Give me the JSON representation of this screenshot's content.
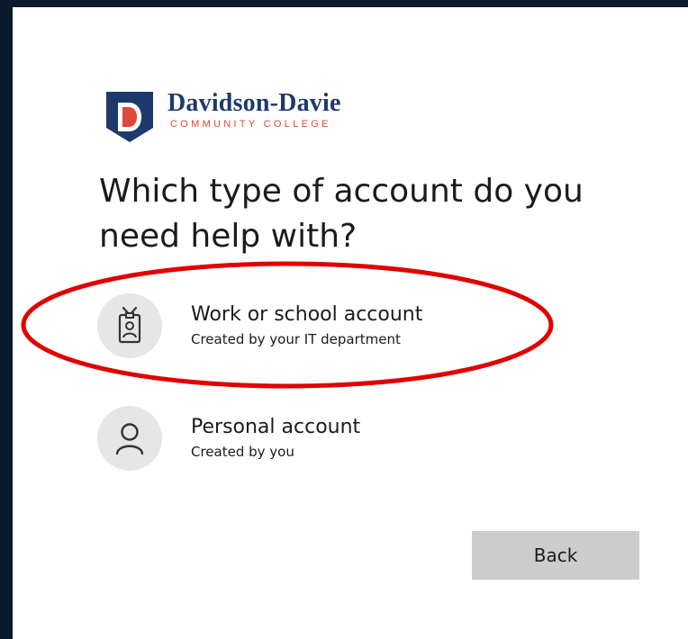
{
  "brand": {
    "name": "Davidson-Davie",
    "subtitle": "COMMUNITY COLLEGE",
    "logo_icon": "shield-d-logo",
    "colors": {
      "navy": "#1d3a6b",
      "red": "#e0463a"
    }
  },
  "heading": "Which type of account do you need help with?",
  "options": [
    {
      "icon": "badge-icon",
      "title": "Work or school account",
      "subtitle": "Created by your IT department",
      "highlighted": true
    },
    {
      "icon": "person-icon",
      "title": "Personal account",
      "subtitle": "Created by you",
      "highlighted": false
    }
  ],
  "back_label": "Back",
  "annotation_color": "#e00000"
}
